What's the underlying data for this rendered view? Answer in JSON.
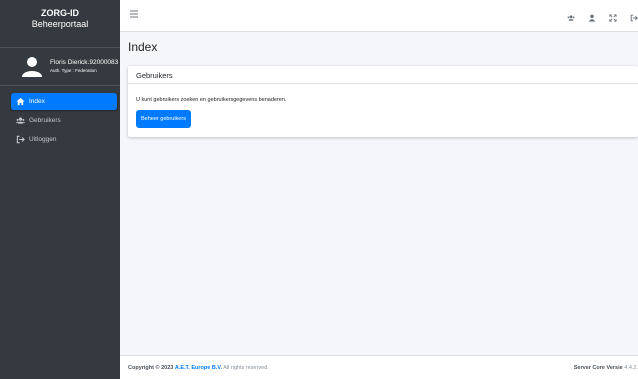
{
  "brand": {
    "title": "ZORG-ID",
    "subtitle": "Beheerportaal"
  },
  "user": {
    "name": "Floris Dierick.92000083",
    "auth_type": "Auth. Type : Federation"
  },
  "nav": [
    {
      "label": "Index",
      "icon": "home-icon",
      "active": true
    },
    {
      "label": "Gebruikers",
      "icon": "users-icon",
      "active": false
    },
    {
      "label": "Uitloggen",
      "icon": "sign-out-icon",
      "active": false
    }
  ],
  "topbar": {
    "icons": [
      "hamburger-icon",
      "users-icon",
      "user-icon",
      "fullscreen-icon",
      "sign-out-icon"
    ]
  },
  "page": {
    "title": "Index"
  },
  "card": {
    "header": "Gebruikers",
    "text": "U kunt gebruikers zoeken en gebruikersgegevens benaderen.",
    "button_label": "Beheer gebruikers"
  },
  "footer": {
    "copyright_prefix": "Copyright © 2023",
    "company": "A.E.T. Europe B.V.",
    "rights": "All rights reserved.",
    "version_label": "Server Core Versie",
    "version_value": "4.4.2."
  },
  "colors": {
    "sidebar": "#343a40",
    "accent": "#007bff",
    "background": "#f4f6f9"
  }
}
